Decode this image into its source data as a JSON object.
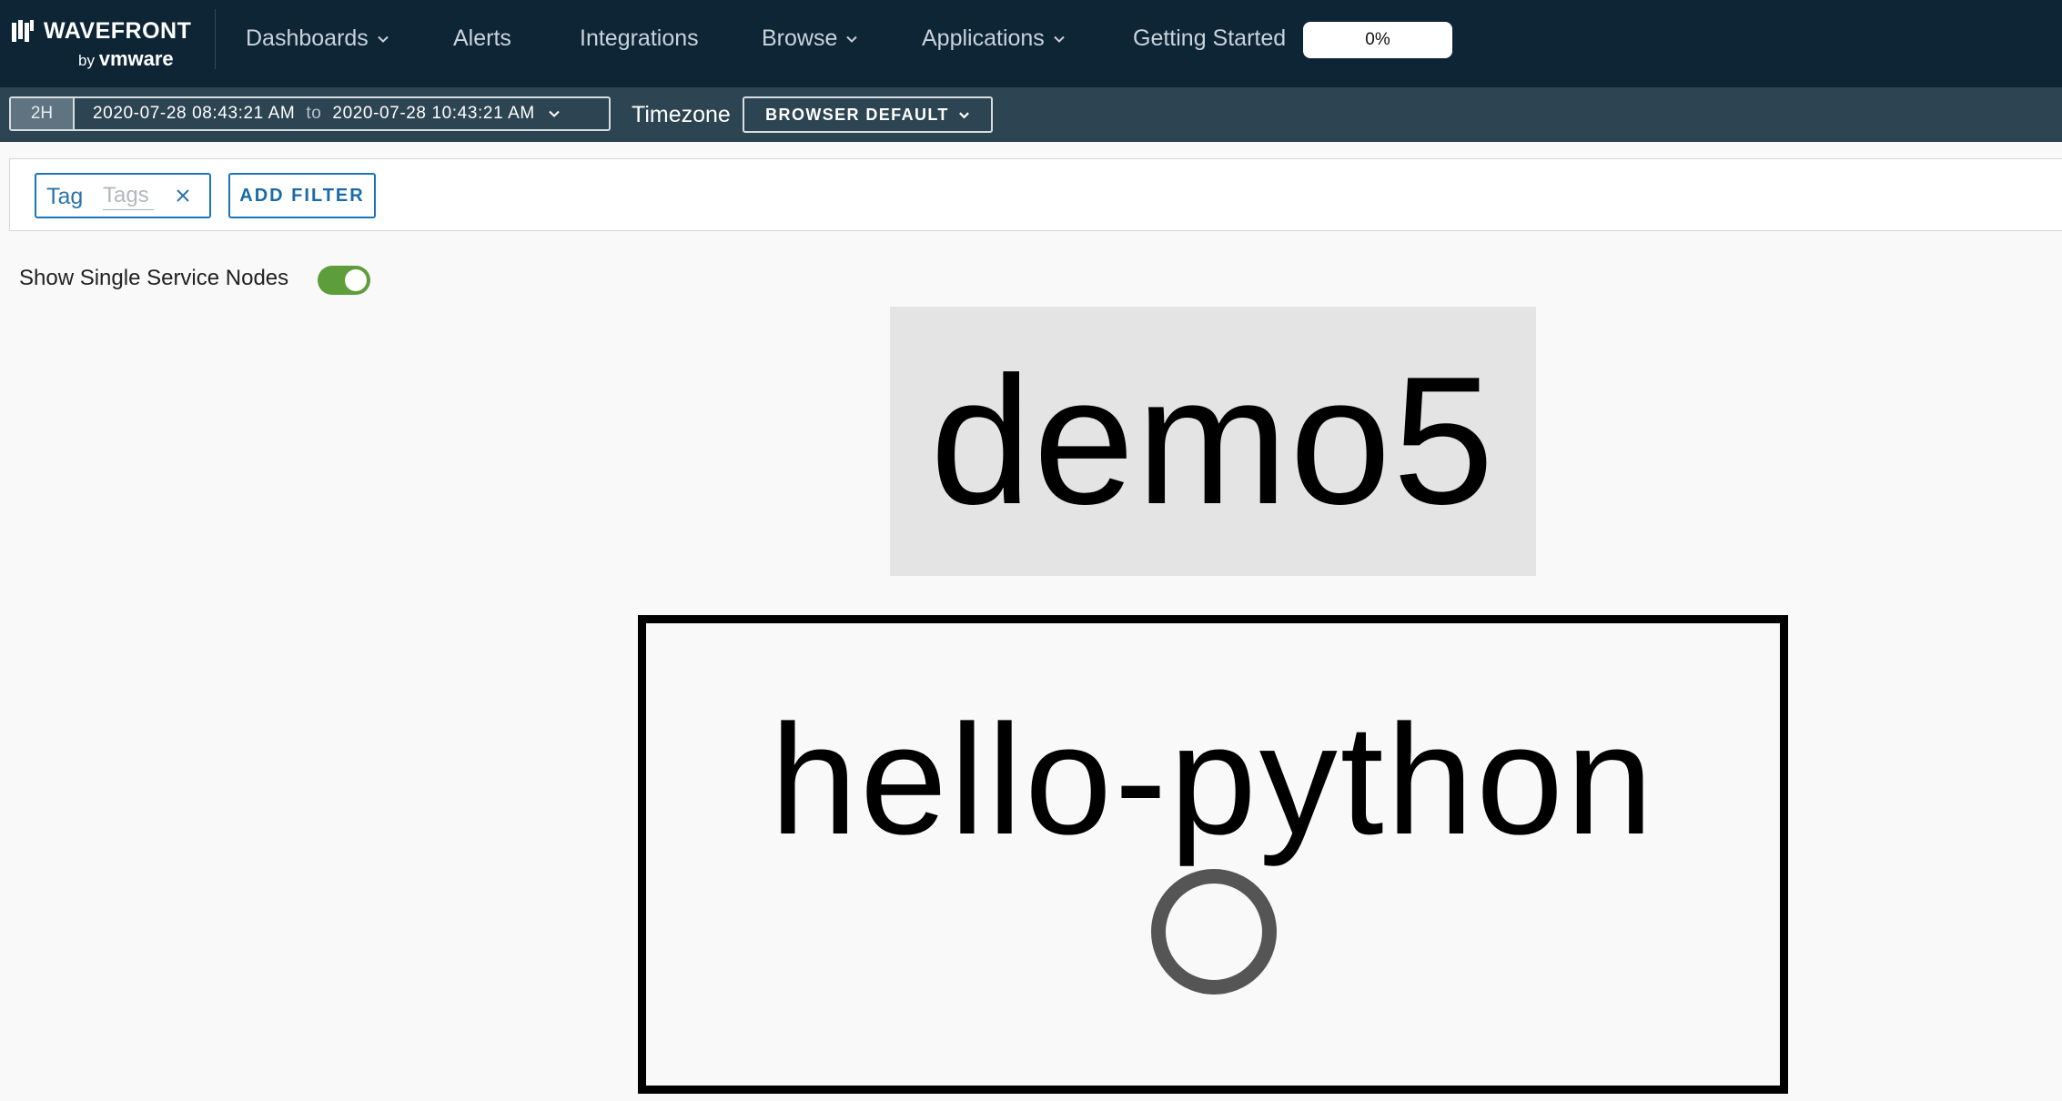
{
  "brand": {
    "name": "WAVEFRONT",
    "by": "by",
    "vendor": "vmware"
  },
  "nav": {
    "items": [
      {
        "label": "Dashboards",
        "dropdown": true
      },
      {
        "label": "Alerts",
        "dropdown": false
      },
      {
        "label": "Integrations",
        "dropdown": false
      },
      {
        "label": "Browse",
        "dropdown": true
      },
      {
        "label": "Applications",
        "dropdown": true
      },
      {
        "label": "Getting Started",
        "dropdown": false
      }
    ],
    "getting_started_progress": "0%"
  },
  "timebar": {
    "range_button": "2H",
    "start": "2020-07-28 08:43:21 AM",
    "to_word": "to",
    "end": "2020-07-28 10:43:21 AM",
    "timezone_label": "Timezone",
    "timezone_value": "BROWSER DEFAULT"
  },
  "filters": {
    "tag_label": "Tag",
    "tag_placeholder": "Tags",
    "add_filter_label": "ADD FILTER"
  },
  "toggle": {
    "label": "Show Single Service Nodes",
    "on": true
  },
  "service_map": {
    "nodes": [
      {
        "name": "demo5",
        "type": "application"
      },
      {
        "name": "hello-python",
        "type": "service"
      }
    ]
  },
  "colors": {
    "nav_bg": "#0e2535",
    "timebar_bg": "#2d4452",
    "accent_blue": "#1a76ba",
    "toggle_green": "#5d9e3a"
  }
}
